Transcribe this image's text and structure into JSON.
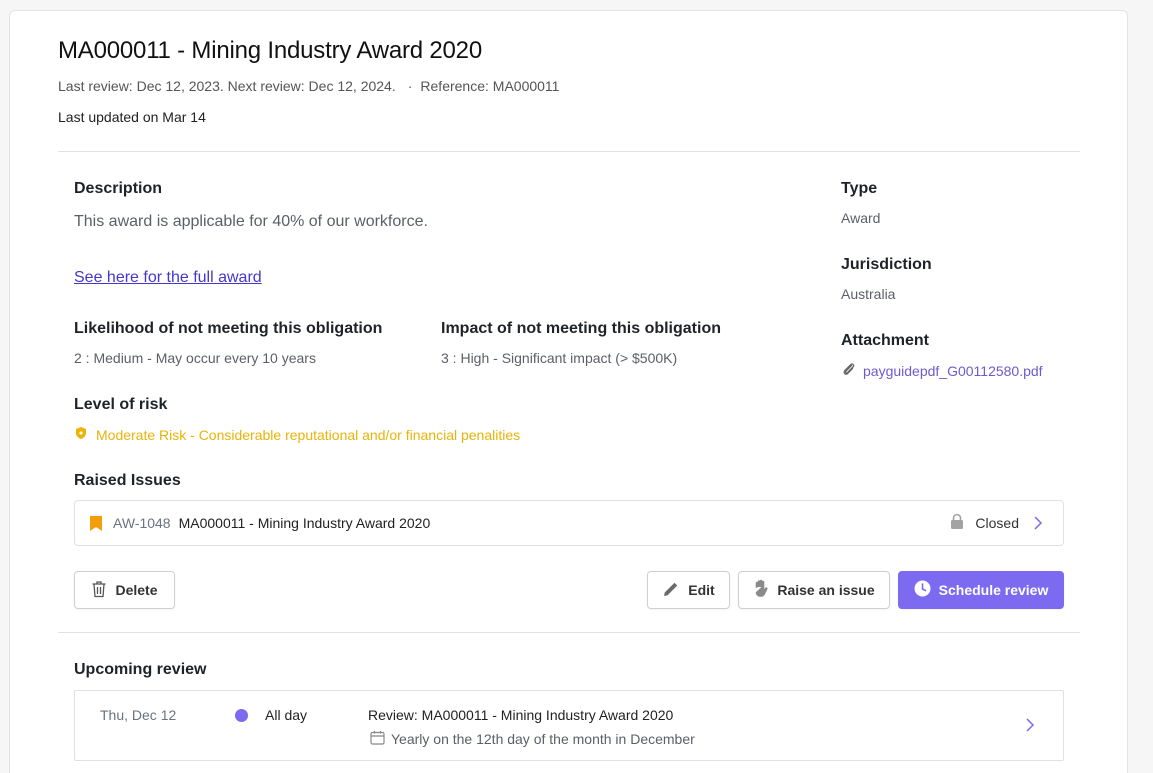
{
  "header": {
    "title": "MA000011 - Mining Industry Award 2020",
    "review_info": "Last review: Dec 12, 2023. Next review: Dec 12, 2024.",
    "separator": "·",
    "reference": "Reference: MA000011",
    "last_updated": "Last updated on Mar 14"
  },
  "description": {
    "heading": "Description",
    "text": "This award is applicable for 40% of our workforce.",
    "link_text": "See here for the full award"
  },
  "likelihood": {
    "heading": "Likelihood of not meeting this obligation",
    "value": "2 : Medium - May occur every 10 years"
  },
  "impact": {
    "heading": "Impact of not meeting this obligation",
    "value": "3 : High - Significant impact (> $500K)"
  },
  "risk": {
    "heading": "Level of risk",
    "value": "Moderate Risk - Considerable reputational and/or financial penalities",
    "color": "#eab308"
  },
  "sidebar": {
    "type_heading": "Type",
    "type_value": "Award",
    "jurisdiction_heading": "Jurisdiction",
    "jurisdiction_value": "Australia",
    "attachment_heading": "Attachment",
    "attachment_file": "payguidepdf_G00112580.pdf"
  },
  "issues": {
    "heading": "Raised Issues",
    "items": [
      {
        "id": "AW-1048",
        "title": "MA000011 - Mining Industry Award 2020",
        "status": "Closed",
        "status_icon": "lock-icon"
      }
    ]
  },
  "actions": {
    "delete_label": "Delete",
    "edit_label": "Edit",
    "raise_label": "Raise an issue",
    "schedule_label": "Schedule review",
    "primary_color": "#7c6af0"
  },
  "upcoming": {
    "heading": "Upcoming review",
    "date": "Thu, Dec 12",
    "time": "All day",
    "title": "Review: MA000011 - Mining Industry Award 2020",
    "recurrence": "Yearly on the 12th day of the month in December"
  }
}
